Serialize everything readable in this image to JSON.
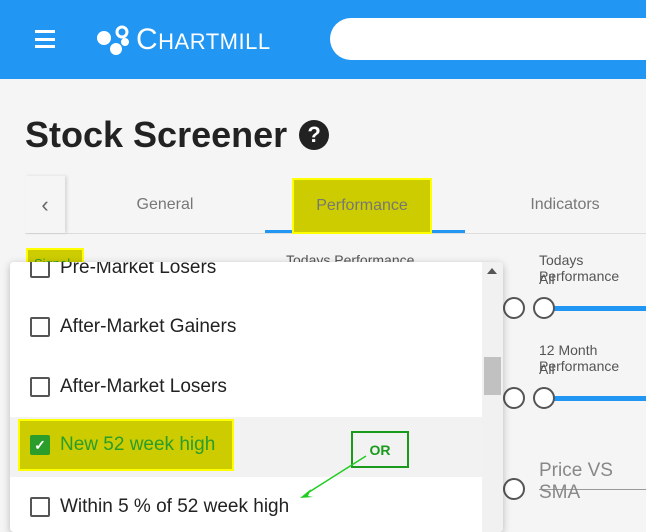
{
  "header": {
    "brand_first": "C",
    "brand_rest": "HARTMILL",
    "brand_first2": "M",
    "brand_rest2": "ILL",
    "menu_icon": "hamburger-icon",
    "search_placeholder": ""
  },
  "page": {
    "title": "Stock Screener",
    "help_icon": "?"
  },
  "tabs": {
    "prev_icon": "‹",
    "items": [
      {
        "label": "General"
      },
      {
        "label": "Performance",
        "active": true
      },
      {
        "label": "Indicators"
      }
    ]
  },
  "filters": {
    "signal_label": "Signal",
    "todays_perf_left": "Todays Performance",
    "todays_perf_right": "Todays Performance",
    "todays_perf_value": "All",
    "month12_perf": "12 Month Performance",
    "month12_value": "All",
    "price_vs_sma_placeholder": "Price VS SMA"
  },
  "dropdown": {
    "items": [
      {
        "label": "Pre-Market Losers",
        "checked": false
      },
      {
        "label": "After-Market Gainers",
        "checked": false
      },
      {
        "label": "After-Market Losers",
        "checked": false
      },
      {
        "label": "New 52 week high",
        "checked": true
      },
      {
        "label": "Within 5 % of 52 week high",
        "checked": false
      }
    ]
  },
  "annotation": {
    "or_label": "OR",
    "highlight_color": "#cccc00",
    "arrow_color": "#22cc22"
  },
  "colors": {
    "brand": "#2196f3",
    "checked": "#2a9d2a"
  }
}
